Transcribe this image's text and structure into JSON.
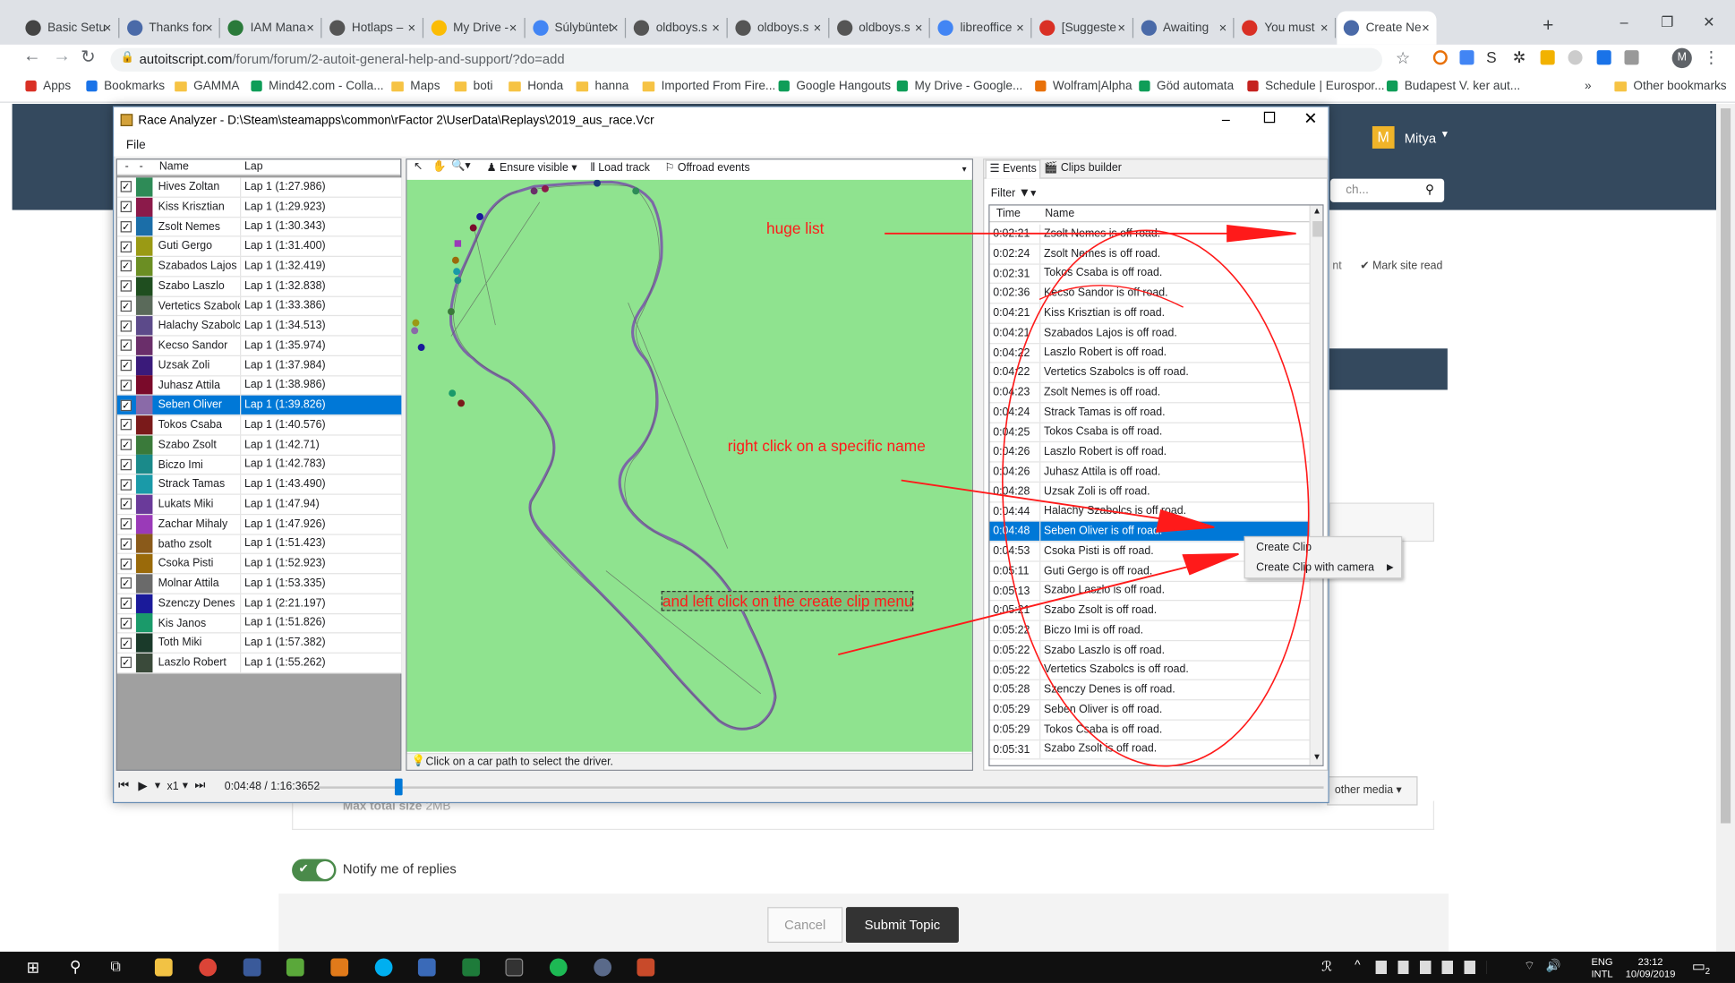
{
  "browser": {
    "tabs": [
      {
        "label": "Basic Setu",
        "icon": "github-icon"
      },
      {
        "label": "Thanks for",
        "icon": "autoit-icon"
      },
      {
        "label": "IAM Mana",
        "icon": "iam-icon"
      },
      {
        "label": "Hotlaps –",
        "icon": "globe-icon"
      },
      {
        "label": "My Drive -",
        "icon": "drive-icon"
      },
      {
        "label": "Súlybüntet",
        "icon": "docs-icon"
      },
      {
        "label": "oldboys.s",
        "icon": "globe-icon"
      },
      {
        "label": "oldboys.s",
        "icon": "globe-icon"
      },
      {
        "label": "oldboys.s",
        "icon": "globe-icon"
      },
      {
        "label": "libreoffice",
        "icon": "google-icon"
      },
      {
        "label": "[Suggeste",
        "icon": "gmail-icon"
      },
      {
        "label": "Awaiting",
        "icon": "autoit-icon"
      },
      {
        "label": "You must",
        "icon": "gmail-icon"
      },
      {
        "label": "Create Ne",
        "icon": "autoit-icon"
      }
    ],
    "url_domain": "autoitscript.com",
    "url_path": "/forum/forum/2-autoit-general-help-and-support/?do=add",
    "bookmarks": [
      "Apps",
      "Bookmarks",
      "GAMMA",
      "Mind42.com - Colla...",
      "Maps",
      "boti",
      "Honda",
      "hanna",
      "Imported From Fire...",
      "Google Hangouts",
      "My Drive - Google...",
      "Wolfram|Alpha",
      "Göd automata",
      "Schedule | Eurospor...",
      "Budapest V. ker aut..."
    ],
    "other_bookmarks": "Other bookmarks",
    "more": "»",
    "profile_letter": "M"
  },
  "forum": {
    "user_name": "Mitya",
    "user_initial": "M",
    "search_placeholder": "ch...",
    "mark_site_read": "Mark site read",
    "nt_fragment": "nt",
    "other_media": "other media",
    "max_total_size_label": "Max total size",
    "max_total_size_value": "2MB",
    "notify_label": "Notify me of replies",
    "cancel": "Cancel",
    "submit": "Submit Topic"
  },
  "app": {
    "title": "Race Analyzer - D:\\Steam\\steamapps\\common\\rFactor 2\\UserData\\Replays\\2019_aus_race.Vcr",
    "menu_file": "File",
    "col_dash1": "-",
    "col_dash2": "-",
    "col_name": "Name",
    "col_lap": "Lap",
    "drivers": [
      {
        "name": "Hives Zoltan",
        "lap": "Lap 1 (1:27.986)",
        "color": "#2e8b57",
        "selected": false
      },
      {
        "name": "Kiss Krisztian",
        "lap": "Lap 1 (1:29.923)",
        "color": "#8b1a4a",
        "selected": false
      },
      {
        "name": "Zsolt Nemes",
        "lap": "Lap 1 (1:30.343)",
        "color": "#1b6ea8",
        "selected": false
      },
      {
        "name": "Guti Gergo",
        "lap": "Lap 1 (1:31.400)",
        "color": "#9a9a14",
        "selected": false
      },
      {
        "name": "Szabados Lajos",
        "lap": "Lap 1 (1:32.419)",
        "color": "#6b8e23",
        "selected": false
      },
      {
        "name": "Szabo Laszlo",
        "lap": "Lap 1 (1:32.838)",
        "color": "#1f4e1f",
        "selected": false
      },
      {
        "name": "Vertetics Szabolcs",
        "lap": "Lap 1 (1:33.386)",
        "color": "#5a6a5a",
        "selected": false
      },
      {
        "name": "Halachy Szabolcs",
        "lap": "Lap 1 (1:34.513)",
        "color": "#5c4a8a",
        "selected": false
      },
      {
        "name": "Kecso Sandor",
        "lap": "Lap 1 (1:35.974)",
        "color": "#6a2e6a",
        "selected": false
      },
      {
        "name": "Uzsak Zoli",
        "lap": "Lap 1 (1:37.984)",
        "color": "#3a1a7a",
        "selected": false
      },
      {
        "name": "Juhasz Attila",
        "lap": "Lap 1 (1:38.986)",
        "color": "#7a0a2a",
        "selected": false
      },
      {
        "name": "Seben Oliver",
        "lap": "Lap 1 (1:39.826)",
        "color": "#8a6aa8",
        "selected": true
      },
      {
        "name": "Tokos Csaba",
        "lap": "Lap 1 (1:40.576)",
        "color": "#7a1a1a",
        "selected": false
      },
      {
        "name": "Szabo Zsolt",
        "lap": "Lap 1 (1:42.71)",
        "color": "#3a7a3a",
        "selected": false
      },
      {
        "name": "Biczo Imi",
        "lap": "Lap 1 (1:42.783)",
        "color": "#1a8a8a",
        "selected": false
      },
      {
        "name": "Strack Tamas",
        "lap": "Lap 1 (1:43.490)",
        "color": "#1a9aa8",
        "selected": false
      },
      {
        "name": "Lukats Miki",
        "lap": "Lap 1 (1:47.94)",
        "color": "#6a3a9a",
        "selected": false
      },
      {
        "name": "Zachar Mihaly",
        "lap": "Lap 1 (1:47.926)",
        "color": "#9a3ab8",
        "selected": false
      },
      {
        "name": "batho zsolt",
        "lap": "Lap 1 (1:51.423)",
        "color": "#8a5a1a",
        "selected": false
      },
      {
        "name": "Csoka Pisti",
        "lap": "Lap 1 (1:52.923)",
        "color": "#9a6a0a",
        "selected": false
      },
      {
        "name": "Molnar Attila",
        "lap": "Lap 1 (1:53.335)",
        "color": "#6a6a6a",
        "selected": false
      },
      {
        "name": "Szenczy Denes",
        "lap": "Lap 1 (2:21.197)",
        "color": "#1a1a9a",
        "selected": false
      },
      {
        "name": "Kis Janos",
        "lap": "Lap 1 (1:51.826)",
        "color": "#1a9a6a",
        "selected": false
      },
      {
        "name": "Toth Miki",
        "lap": "Lap 1 (1:57.382)",
        "color": "#1a3a2a",
        "selected": false
      },
      {
        "name": "Laszlo Robert",
        "lap": "Lap 1 (1:55.262)",
        "color": "#3a4a3a",
        "selected": false
      }
    ],
    "map_toolbar": {
      "ensure_visible": "Ensure visible",
      "load_track": "Load track",
      "offroad_events": "Offroad events"
    },
    "map_status": "Click on a car path to select the driver.",
    "tabs": {
      "events": "Events",
      "clips": "Clips builder"
    },
    "filter": "Filter",
    "events_cols": {
      "time": "Time",
      "name": "Name"
    },
    "events": [
      {
        "time": "0:02:21",
        "name": "Zsolt Nemes is off road.",
        "selected": false
      },
      {
        "time": "0:02:24",
        "name": "Zsolt Nemes is off road.",
        "selected": false
      },
      {
        "time": "0:02:31",
        "name": "Tokos Csaba is off road.",
        "selected": false
      },
      {
        "time": "0:02:36",
        "name": "Kecso Sandor is off road.",
        "selected": false
      },
      {
        "time": "0:04:21",
        "name": "Kiss Krisztian is off road.",
        "selected": false
      },
      {
        "time": "0:04:21",
        "name": "Szabados Lajos is off road.",
        "selected": false
      },
      {
        "time": "0:04:22",
        "name": "Laszlo Robert is off road.",
        "selected": false
      },
      {
        "time": "0:04:22",
        "name": "Vertetics Szabolcs is off road.",
        "selected": false
      },
      {
        "time": "0:04:23",
        "name": "Zsolt Nemes is off road.",
        "selected": false
      },
      {
        "time": "0:04:24",
        "name": "Strack Tamas is off road.",
        "selected": false
      },
      {
        "time": "0:04:25",
        "name": "Tokos Csaba is off road.",
        "selected": false
      },
      {
        "time": "0:04:26",
        "name": "Laszlo Robert is off road.",
        "selected": false
      },
      {
        "time": "0:04:26",
        "name": "Juhasz Attila is off road.",
        "selected": false
      },
      {
        "time": "0:04:28",
        "name": "Uzsak Zoli is off road.",
        "selected": false
      },
      {
        "time": "0:04:44",
        "name": "Halachy Szabolcs is off road.",
        "selected": false
      },
      {
        "time": "0:04:48",
        "name": "Seben Oliver is off road.",
        "selected": true
      },
      {
        "time": "0:04:53",
        "name": "Csoka Pisti is off road.",
        "selected": false
      },
      {
        "time": "0:05:11",
        "name": "Guti Gergo is off road.",
        "selected": false
      },
      {
        "time": "0:05:13",
        "name": "Szabo Laszlo is off road.",
        "selected": false
      },
      {
        "time": "0:05:21",
        "name": "Szabo Zsolt is off road.",
        "selected": false
      },
      {
        "time": "0:05:22",
        "name": "Biczo Imi is off road.",
        "selected": false
      },
      {
        "time": "0:05:22",
        "name": "Szabo Laszlo is off road.",
        "selected": false
      },
      {
        "time": "0:05:22",
        "name": "Vertetics Szabolcs is off road.",
        "selected": false
      },
      {
        "time": "0:05:28",
        "name": "Szenczy Denes is off road.",
        "selected": false
      },
      {
        "time": "0:05:29",
        "name": "Seben Oliver is off road.",
        "selected": false
      },
      {
        "time": "0:05:29",
        "name": "Tokos Csaba is off road.",
        "selected": false
      },
      {
        "time": "0:05:31",
        "name": "Szabo Zsolt is off road.",
        "selected": false
      }
    ],
    "context_menu": [
      "Create Clip",
      "Create Clip with camera"
    ],
    "playback": {
      "speed": "x1",
      "time": "0:04:48 / 1:16:3652",
      "position": 0.077
    }
  },
  "annotations": {
    "huge_list": "huge list",
    "right_click": "right click on a specific name",
    "left_click": "and left click on the create clip menu"
  },
  "taskbar": {
    "lang1": "ENG",
    "lang2": "INTL",
    "time": "23:12",
    "date": "10/09/2019",
    "notif": "2"
  },
  "colors": {
    "accent": "#0078d7",
    "map_green": "#8fe38f",
    "annotation_red": "#ff1a1a",
    "forum_header": "#34495e"
  }
}
